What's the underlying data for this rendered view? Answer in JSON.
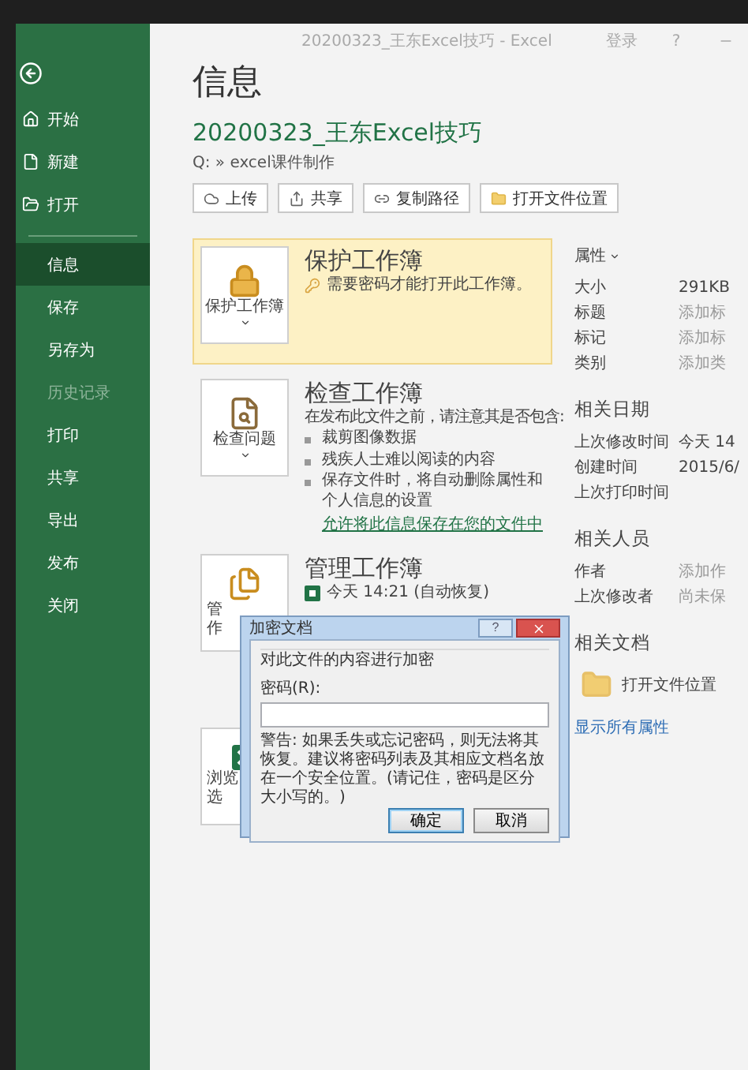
{
  "window": {
    "title": "20200323_王东Excel技巧  -  Excel",
    "sign_in": "登录",
    "help": "?"
  },
  "sidebar": {
    "items": [
      {
        "label": "开始",
        "kind": "nav",
        "selected": false,
        "disabled": false
      },
      {
        "label": "新建",
        "kind": "nav",
        "selected": false,
        "disabled": false
      },
      {
        "label": "打开",
        "kind": "nav",
        "selected": false,
        "disabled": false
      },
      {
        "label": "信息",
        "kind": "page",
        "selected": true,
        "disabled": false
      },
      {
        "label": "保存",
        "kind": "page",
        "selected": false,
        "disabled": false
      },
      {
        "label": "另存为",
        "kind": "page",
        "selected": false,
        "disabled": false
      },
      {
        "label": "历史记录",
        "kind": "page",
        "selected": false,
        "disabled": true
      },
      {
        "label": "打印",
        "kind": "page",
        "selected": false,
        "disabled": false
      },
      {
        "label": "共享",
        "kind": "page",
        "selected": false,
        "disabled": false
      },
      {
        "label": "导出",
        "kind": "page",
        "selected": false,
        "disabled": false
      },
      {
        "label": "发布",
        "kind": "page",
        "selected": false,
        "disabled": false
      },
      {
        "label": "关闭",
        "kind": "page",
        "selected": false,
        "disabled": false
      }
    ]
  },
  "page": {
    "heading": "信息",
    "file_name": "20200323_王东Excel技巧",
    "path": "Q: » excel课件制作",
    "actions": [
      {
        "label": "上传",
        "kind": "upload"
      },
      {
        "label": "共享",
        "kind": "share"
      },
      {
        "label": "复制路径",
        "kind": "link"
      },
      {
        "label": "打开文件位置",
        "kind": "folder"
      }
    ]
  },
  "cards": [
    {
      "kind": "protect",
      "highlighted": true,
      "button_lines": [
        "保护工作簿"
      ],
      "title": "保护工作簿",
      "note": "需要密码才能打开此工作簿。"
    },
    {
      "kind": "inspect",
      "highlighted": false,
      "button_lines": [
        "检查问题"
      ],
      "title": "检查工作簿",
      "description": "在发布此文件之前，请注意其是否包含:",
      "bullets": [
        "裁剪图像数据",
        "残疾人士难以阅读的内容",
        "保存文件时，将自动删除属性和个人信息的设置"
      ],
      "link": "允许将此信息保存在您的文件中"
    },
    {
      "kind": "manage",
      "highlighted": false,
      "button_lines": [
        "管",
        "作"
      ],
      "title": "管理工作簿",
      "note": "今天 14:21 (自动恢复)"
    },
    {
      "kind": "browser",
      "highlighted": false,
      "button_lines": [
        "浏览",
        "选"
      ]
    }
  ],
  "properties": {
    "heading": "属性",
    "rows": [
      {
        "label": "大小",
        "value": "291KB",
        "kind": "value"
      },
      {
        "label": "标题",
        "value": "添加标",
        "kind": "hint"
      },
      {
        "label": "标记",
        "value": "添加标",
        "kind": "hint"
      },
      {
        "label": "类别",
        "value": "添加类",
        "kind": "hint"
      }
    ]
  },
  "dates": {
    "heading": "相关日期",
    "rows": [
      {
        "label": "上次修改时间",
        "value": "今天 14",
        "kind": "value"
      },
      {
        "label": "创建时间",
        "value": "2015/6/",
        "kind": "value"
      },
      {
        "label": "上次打印时间"
      }
    ]
  },
  "people": {
    "heading": "相关人员",
    "rows": [
      {
        "label": "作者",
        "value": "添加作",
        "kind": "hint"
      },
      {
        "label": "上次修改者",
        "value": "尚未保",
        "kind": "hint"
      }
    ]
  },
  "documents": {
    "heading": "相关文档",
    "items": [
      "打开文件位置"
    ],
    "show_all": "显示所有属性"
  },
  "dialog": {
    "title": "加密文档",
    "help": "?",
    "group": "对此文件的内容进行加密",
    "field_label": "密码(R):",
    "warning": "警告: 如果丢失或忘记密码，则无法将其恢复。建议将密码列表及其相应文档名放在一个安全位置。(请记住，密码是区分大小写的。)",
    "buttons": [
      {
        "label": "确定",
        "default": true
      },
      {
        "label": "取消",
        "default": false
      }
    ]
  }
}
